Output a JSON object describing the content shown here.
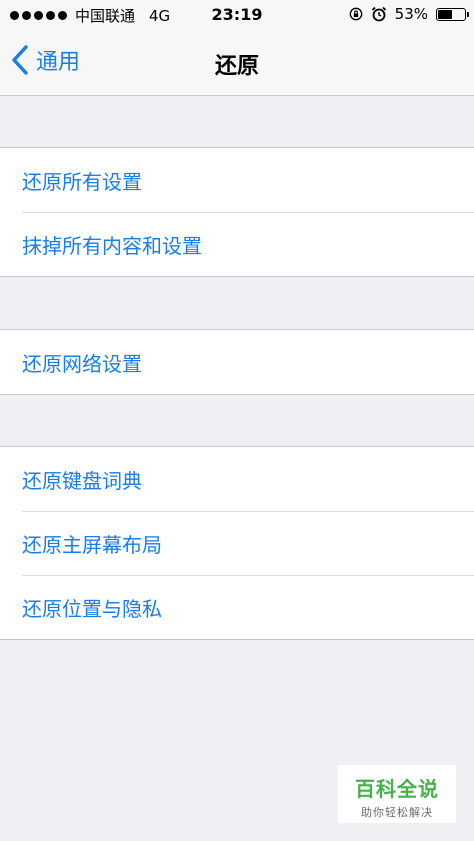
{
  "status_bar": {
    "carrier": "中国联通",
    "network": "4G",
    "time": "23:19",
    "battery": "53%",
    "battery_level": 0.53
  },
  "nav": {
    "back_label": "通用",
    "title": "还原"
  },
  "groups": [
    {
      "items": [
        "还原所有设置",
        "抹掉所有内容和设置"
      ]
    },
    {
      "items": [
        "还原网络设置"
      ]
    },
    {
      "items": [
        "还原键盘词典",
        "还原主屏幕布局",
        "还原位置与隐私"
      ]
    }
  ],
  "watermark": {
    "title": "百科全说",
    "subtitle": "助你轻松解决"
  },
  "colors": {
    "accent": "#1a7ee6",
    "background": "#efeff4"
  }
}
